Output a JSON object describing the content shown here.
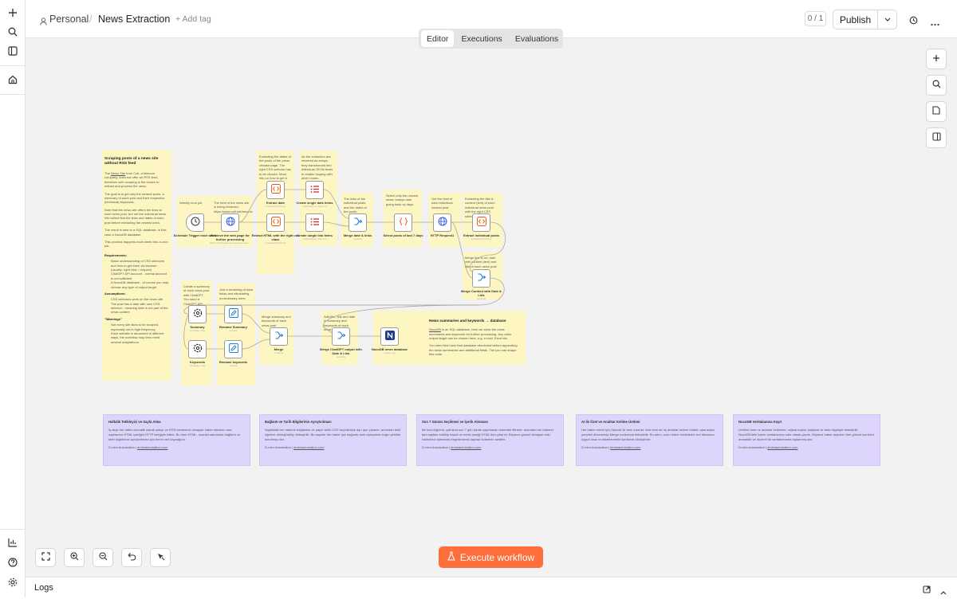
{
  "sidebar": {
    "icons": [
      "plus-icon",
      "search-icon",
      "panel-icon",
      "home-icon",
      "insights-icon",
      "help-icon",
      "settings-icon"
    ]
  },
  "header": {
    "project": "Personal",
    "separator": "/",
    "workflow_name": "News Extraction",
    "add_tag": "+ Add tag",
    "version_count": "0 / 1",
    "publish_label": "Publish"
  },
  "tabs": [
    {
      "label": "Editor",
      "active": true
    },
    {
      "label": "Executions",
      "active": false
    },
    {
      "label": "Evaluations",
      "active": false
    }
  ],
  "main_sticky": {
    "title": "Scraping posts of a news site without RSS feed",
    "p1_pre": "The ",
    "p1_link": "News Site",
    "p1_post": " from Colt, a telecom company, does not offer an RSS feed, therefore web scraping is the choice to extract and process the news.",
    "p2": "The goal is to get only the newest posts, a summary of each post and their respective (technical) keywords.",
    "p3": "Note that the news site offers the links to each news post, but not the individual news. We collect first the links and dates of each post before extracting the newest ones.",
    "p4": "The result is sent to a SQL database, in this case a NocoDB database.",
    "p5": "This process happens each week thru a cron job.",
    "req_title": "Requirements:",
    "req_1": "Basic understanding of CSS selectors and how to get them via browser (usually: right click > inspect)",
    "req_2": "ChatGPT API account - normal account is not sufficient",
    "req_3": "A NocoDB database - of course you may choose any type of output target",
    "assump_title": "Assumptions:",
    "assump_1": "CSS selectors work on the news site",
    "assump_2": "The post has a date with own CSS selector - meaning date is not part of the news content",
    "warn_title": "\"Warnings\"",
    "warn_1": "Not every site likes to be scraped, especially not in high frequency",
    "warn_2": "Each website is structured in different ways, the workflow may then need several adaptations."
  },
  "notes": {
    "weekly": "Weekly cron job",
    "html_first": "The html of the news site is being retrieved: https://www.colt.net/resources/type/news/",
    "extract_dates": "Extracting the dates of the posts of the press release page. The right CSS selector has to be chosen. More info on how to get it",
    "extraction_arrays": "As the extraction are returned as arrays, they transformed into individual JSON items to enable looping with other nodes.",
    "links_merged": "The links of the individual posts and the dates of the posts",
    "select_newest": "Select only the newest news: todays date going back xy days",
    "get_html": "Get the html of each individual newest post",
    "extract_title": "Extracting the title & content (text) of each individual news post with the right CSS selector.",
    "merge_link": "Merge link to url, date with content (text) and title of each news post",
    "create_summary": "Create a summary of each news post with ChatGPT. You need a ChatGPT API account for this",
    "renaming": "Just a renaming of data fields and eliminating unnecessary ones",
    "merge_summary": "Merge summary and keywords of each news post",
    "add_title": "Add title, link and date to summary and keywords of each news post",
    "nocodb_title": "News summaries and keywords → database",
    "nocodb_body_pre": "NocoDB",
    "nocodb_body": " is an SQL database, here we store the news summaries and keywords for further processing. Any other output target can be chosen here, e.g. e-mail, Excel etc.",
    "nocodb_body2": "You need first have that database structured before appending the news summaries and additional fields. The you can shape this node."
  },
  "nodes": [
    {
      "id": "schedule",
      "label": "Schedule Trigger each week",
      "sub": "",
      "icon": "clock-icon"
    },
    {
      "id": "retrieve",
      "label": "Retrieve the web page for further processing",
      "sub": "GET: https://www.colt.net/resources/...",
      "icon": "globe-icon"
    },
    {
      "id": "extract_date",
      "label": "Extract date",
      "sub": "extractHtmlContent",
      "icon": "code-icon"
    },
    {
      "id": "extract_html",
      "label": "Extract HTML with the right css class",
      "sub": "extractHtmlContent",
      "icon": "code-icon"
    },
    {
      "id": "split_date",
      "label": "Create single date items",
      "sub": "splitOutItems: date.md",
      "icon": "list-icon"
    },
    {
      "id": "split_link",
      "label": "Create single link items",
      "sub": "splitOutItems: links.md",
      "icon": "list-icon"
    },
    {
      "id": "merge_date_links",
      "label": "Merge date & links",
      "sub": "combine",
      "icon": "merge-icon"
    },
    {
      "id": "select_posts",
      "label": "Select posts of last 7 days",
      "sub": "",
      "icon": "braces-icon"
    },
    {
      "id": "http_request",
      "label": "HTTP Request1",
      "sub": "",
      "icon": "globe-icon"
    },
    {
      "id": "extract_posts",
      "label": "Extract individual posts",
      "sub": "extractHtmlContent",
      "icon": "code-icon"
    },
    {
      "id": "merge_content",
      "label": "Merge Content with Date & Link",
      "sub": "combine",
      "icon": "merge-icon"
    },
    {
      "id": "summary",
      "label": "Summary",
      "sub": "complete: chat",
      "icon": "openai-icon"
    },
    {
      "id": "keywords",
      "label": "Keywords",
      "sub": "complete: chat",
      "icon": "openai-icon"
    },
    {
      "id": "rename_summary",
      "label": "Rename Summary",
      "sub": "manual",
      "icon": "pen-icon"
    },
    {
      "id": "rename_keywords",
      "label": "Rename keywords",
      "sub": "manual",
      "icon": "pen-icon"
    },
    {
      "id": "merge",
      "label": "Merge",
      "sub": "combine",
      "icon": "merge-icon"
    },
    {
      "id": "merge_chatgpt",
      "label": "Merge ChatGPT output with Date & Link",
      "sub": "combine",
      "icon": "merge-icon"
    },
    {
      "id": "nocodb",
      "label": "NocoDB news database",
      "sub": "create: row",
      "icon": "nocodb-icon"
    }
  ],
  "purple_notes": [
    {
      "title": "Haftalık Tetikleyici ve Sayfa Alma",
      "body": "İş akışı her hafta otomatik olarak çalışır ve RSS beslemesi olmayan haber sitesinin ana sayfasının HTML içeriğini HTTP isteğiyle indirir. Bu ham HTML, sonraki adımlarda bağlantı ve tarih bilgilerinin ayrıştırılması için temel veri kaynağıdır.",
      "footer_pre": "D-mim Automation | ",
      "footer_link": "dmimautomation.com"
    },
    {
      "title": "Bağlantı ve Tarih Bilgilerinin Ayrıştırılması",
      "body": "Sayfadaki her haberin bağlantısı ve yayın tarihi CSS seçicileriyle ayrı ayrı çıkarılır, ardından tekil öğelere dönüştürülüp birleştirilir. Bu sayede her haber için bağlantı-tarih eşleşmesi doğru şekilde kurulmuş olur.",
      "footer_pre": "D-mim Automation | ",
      "footer_link": "dmimautomation.com"
    },
    {
      "title": "Son 7 Günün Seçilmesi ve İçerik Alınması",
      "body": "Bir kod düğümü, yalnızca son 7 gün içinde yayınlanan haberleri filtreler; ardından her haberin tam sayfası indirilip başlık ve metin içeriği HTML'den çıkarılır. Böylece güncel olmayan eski haberlerin işlenmesi engellenerek kaynak kullanımı azaltılır.",
      "footer_pre": "D-mim Automation | ",
      "footer_link": "dmimautomation.com"
    },
    {
      "title": "AI ile Özet ve Anahtar Kelime Üretimi",
      "body": "Her haber metni için OpenAI ile hem kısa bir özet hem de üç anahtar kelime üretilir; alan adları yeniden düzenlenip Merge nodeunda birleştirilir. Bu adım, uzun haber metinlerini veri tabanına uygun kısa ve etiketlenebilir içeriklere dönüştürür.",
      "footer_pre": "D-mim Automation | ",
      "footer_link": "dmimautomation.com"
    },
    {
      "title": "NocoDB Veritabanına Kayıt",
      "body": "Üretilen özet ve anahtar kelimeler, orijinal başlık, bağlantı ve tarih bilgisiyle birleştirilir. NocoDB'deki haber veritabanına satır olarak yazılır. Böylece haber arşivinin tüm güncel içerikleri aranabilir ve düzenli bir veritabanında toplanmış olur.",
      "footer_pre": "D-mim Automation | ",
      "footer_link": "dmimautomation.com"
    }
  ],
  "canvas_tools": [
    "zoom-to-fit-icon",
    "zoom-in-icon",
    "zoom-out-icon",
    "undo-icon",
    "tidy-up-icon"
  ],
  "right_tools": [
    "plus-icon",
    "search-icon",
    "sticky-note-icon",
    "panel-icon"
  ],
  "execute_label": "Execute workflow",
  "logs_label": "Logs",
  "colors": {
    "accent": "#ff6d3a",
    "sticky": "#fdf6c3",
    "purple": "#ddd5fb",
    "canvas": "#f2f2f2"
  }
}
